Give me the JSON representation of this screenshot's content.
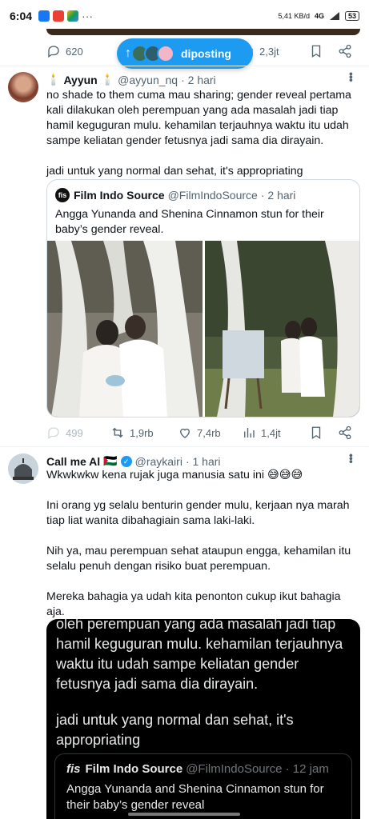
{
  "status_bar": {
    "time": "6:04",
    "dots": "···",
    "net_speed": "5,41 KB/d",
    "net_type": "4G",
    "battery": "53"
  },
  "top_actions": {
    "replies": "620",
    "views": "2,3jt"
  },
  "posted_pill": {
    "label": "diposting"
  },
  "tweet1": {
    "name": "Ayyun",
    "name_decor": "🕯️",
    "handle": "@ayyun_nq",
    "time": "· 2 hari",
    "body": [
      "no shade to them cuma mau sharing; gender reveal pertama kali dilakukan oleh perempuan yang ada masalah jadi tiap hamil keguguran mulu. kehamilan terjauhnya waktu itu udah sampe keliatan gender fetusnya jadi sama dia dirayain.",
      "jadi untuk yang normal dan sehat, it's appropriating"
    ],
    "quote": {
      "logo": "fis",
      "name": "Film Indo Source",
      "handle": "@FilmIndoSource",
      "time": "· 2 hari",
      "text": "Angga Yunanda and Shenina Cinnamon stun for their baby’s gender reveal."
    },
    "actions": {
      "replies": "499",
      "retweets": "1,9rb",
      "likes": "7,4rb",
      "views": "1,4jt"
    }
  },
  "tweet2": {
    "name": "Call me Al",
    "flag": "🇵🇸",
    "handle": "@raykairi",
    "time": "· 1 hari",
    "body": [
      "Wkwkwkw kena rujak juga manusia satu ini 😅😅😅",
      "Ini orang yg selalu benturin gender mulu, kerjaan nya marah tiap liat wanita dibahagiain sama laki-laki.",
      "Nih ya, mau perempuan sehat ataupun engga, kehamilan itu selalu penuh dengan risiko buat perempuan.",
      "Mereka bahagia ya udah kita penonton cukup ikut bahagia aja."
    ],
    "screenshot": {
      "text": [
        "oleh perempuan yang ada masalah jadi tiap hamil keguguran mulu. kehamilan terjauhnya waktu itu udah sampe keliatan gender fetusnya jadi sama dia dirayain.",
        "jadi untuk yang normal dan sehat, it's appropriating"
      ],
      "quote_name": "Film Indo Source",
      "quote_handle": "@FilmIndoSource · 12 jam",
      "quote_text": "Angga Yunanda and Shenina Cinnamon stun for their baby’s gender reveal"
    }
  }
}
